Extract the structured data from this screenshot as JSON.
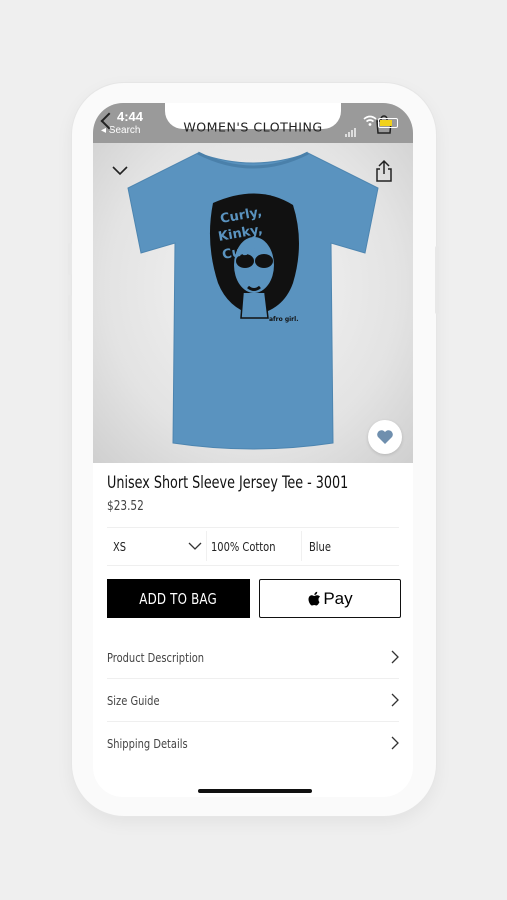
{
  "status_bar": {
    "time": "4:44",
    "back_label": "◂ Search"
  },
  "nav": {
    "title": "WOMEN'S CLOTHING"
  },
  "hero": {
    "shirt_color": "#5a93bf",
    "print_text_1": "Curly,",
    "print_text_2": "Kinky,",
    "print_text_3": "Cute",
    "print_brand": "afro girl."
  },
  "product": {
    "title": "Unisex Short Sleeve Jersey Tee - 3001",
    "price": "$23.52"
  },
  "options": {
    "size": "XS",
    "material": "100% Cotton",
    "color": "Blue"
  },
  "actions": {
    "add_to_bag": "ADD TO BAG",
    "apple_pay": "Pay"
  },
  "details": [
    {
      "label": "Product Description"
    },
    {
      "label": "Size Guide"
    },
    {
      "label": "Shipping Details"
    }
  ],
  "colors": {
    "status_bar_bg": "#9a9a9a",
    "accent": "#000000",
    "favorite": "#6f8fae"
  }
}
